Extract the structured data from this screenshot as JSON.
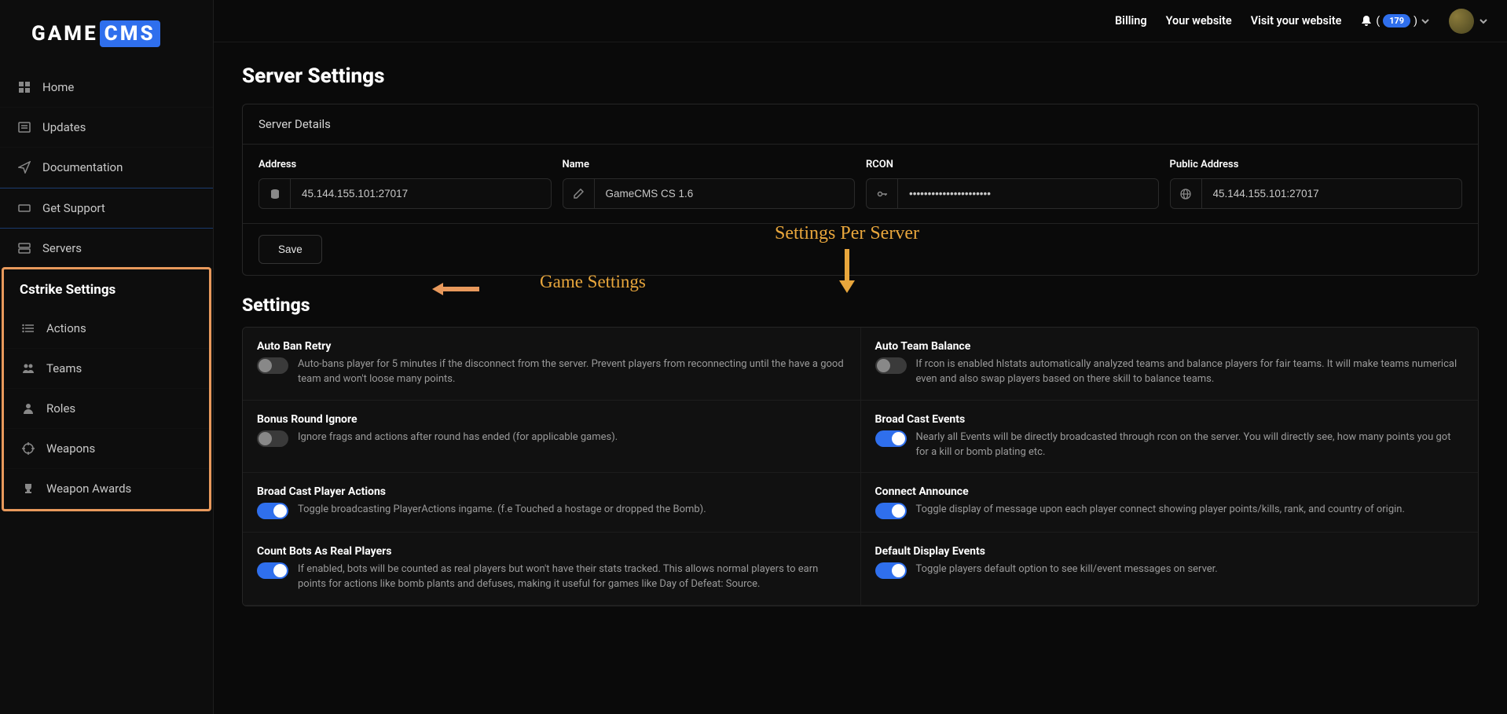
{
  "brand": {
    "part1": "GAME",
    "part2": "CMS"
  },
  "topbar": {
    "links": [
      "Billing",
      "Your website",
      "Visit your website"
    ],
    "notif_count": "179"
  },
  "sidebar": {
    "items": [
      {
        "label": "Home"
      },
      {
        "label": "Updates"
      },
      {
        "label": "Documentation"
      },
      {
        "label": "Get Support"
      },
      {
        "label": "Servers"
      }
    ],
    "section_title": "Cstrike Settings",
    "sub_items": [
      {
        "label": "Actions"
      },
      {
        "label": "Teams"
      },
      {
        "label": "Roles"
      },
      {
        "label": "Weapons"
      },
      {
        "label": "Weapon Awards"
      }
    ]
  },
  "page_title": "Server Settings",
  "server_details": {
    "header": "Server Details",
    "fields": {
      "address": {
        "label": "Address",
        "value": "45.144.155.101:27017"
      },
      "name": {
        "label": "Name",
        "value": "GameCMS CS 1.6"
      },
      "rcon": {
        "label": "RCON",
        "value": "••••••••••••••••••••••"
      },
      "public_address": {
        "label": "Public Address",
        "value": "45.144.155.101:27017"
      }
    },
    "save_label": "Save"
  },
  "settings_title": "Settings",
  "annotations": {
    "game_settings": "Game Settings",
    "per_server": "Settings Per Server"
  },
  "settings": [
    [
      {
        "title": "Auto Ban Retry",
        "on": false,
        "desc": "Auto-bans player for 5 minutes if the disconnect from the server. Prevent players from reconnecting until the have a good team and won't loose many points."
      },
      {
        "title": "Auto Team Balance",
        "on": false,
        "desc": "If rcon is enabled hlstats automatically analyzed teams and balance players for fair teams. It will make teams numerical even and also swap players based on there skill to balance teams."
      }
    ],
    [
      {
        "title": "Bonus Round Ignore",
        "on": false,
        "desc": "Ignore frags and actions after round has ended (for applicable games)."
      },
      {
        "title": "Broad Cast Events",
        "on": true,
        "desc": "Nearly all Events will be directly broadcasted through rcon on the server. You will directly see, how many points you got for a kill or bomb plating etc."
      }
    ],
    [
      {
        "title": "Broad Cast Player Actions",
        "on": true,
        "desc": "Toggle broadcasting PlayerActions ingame. (f.e Touched a hostage or dropped the Bomb)."
      },
      {
        "title": "Connect Announce",
        "on": true,
        "desc": "Toggle display of message upon each player connect showing player points/kills, rank, and country of origin."
      }
    ],
    [
      {
        "title": "Count Bots As Real Players",
        "on": true,
        "desc": "If enabled, bots will be counted as real players but won't have their stats tracked. This allows normal players to earn points for actions like bomb plants and defuses, making it useful for games like Day of Defeat: Source."
      },
      {
        "title": "Default Display Events",
        "on": true,
        "desc": "Toggle players default option to see kill/event messages on server."
      }
    ]
  ]
}
